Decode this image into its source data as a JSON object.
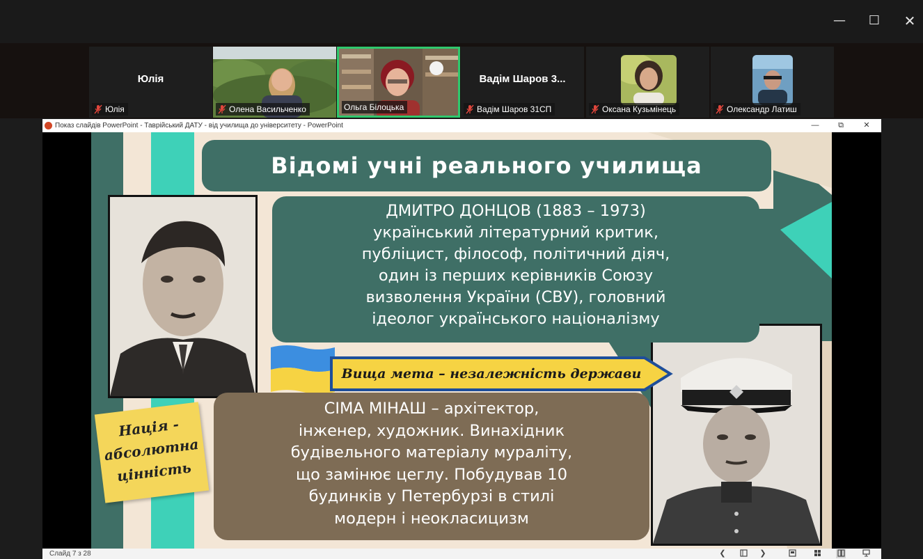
{
  "window_controls": {
    "minimize": "—",
    "maximize": "☐",
    "close": "✕"
  },
  "participants": [
    {
      "display": "Юлія",
      "tag": "Юлія",
      "video": false
    },
    {
      "display": "",
      "tag": "Олена Васильченко",
      "video": true
    },
    {
      "display": "",
      "tag": "Ольга Білоцька",
      "video": true,
      "active": true
    },
    {
      "display": "Вадім Шаров 3...",
      "tag": "Вадім Шаров 31СП",
      "video": false
    },
    {
      "display": "",
      "tag": "Оксана Кузьмінець",
      "video": true
    },
    {
      "display": "",
      "tag": "Олександр Латиш",
      "video": true
    }
  ],
  "ppt": {
    "title": "Показ слайдів PowerPoint  -  Таврійський ДАТУ - від училища до університету - PowerPoint",
    "controls": {
      "minimize": "—",
      "restore": "⧉",
      "close": "✕"
    },
    "status": "Слайд 7 з 28",
    "nav": {
      "prev": "❮",
      "next": "❯"
    }
  },
  "slide": {
    "title": "Відомі учні реального училища",
    "donzov_lines": [
      "ДМИТРО ДОНЦОВ  (1883 – 1973)",
      "український літературний критик,",
      "публіцист, філософ, політичний діяч,",
      "один із перших керівників Союзу",
      "визволення України (СВУ), головний",
      "ідеолог українського націоналізму"
    ],
    "banner": "Вища мета – незалежність держави",
    "sticky_lines": [
      "Нація -",
      "абсолютна",
      "цінність"
    ],
    "minash_lines": [
      "СІМА МІНАШ –  архітектор,",
      "інженер, художник. Винахідник",
      "будівельного матеріалу мураліту,",
      "що замінює цеглу. Побудував 10",
      "будинків у Петербурзі в стилі",
      "модерн і неокласицизм"
    ]
  },
  "colors": {
    "teal_dark": "#3f6f66",
    "teal_light": "#3ed1b8",
    "brown": "#7e6c55",
    "yellow": "#f4d65a",
    "flag_blue": "#3c8ee0",
    "flag_yellow": "#f6d343",
    "active_green": "#2fc86d"
  }
}
